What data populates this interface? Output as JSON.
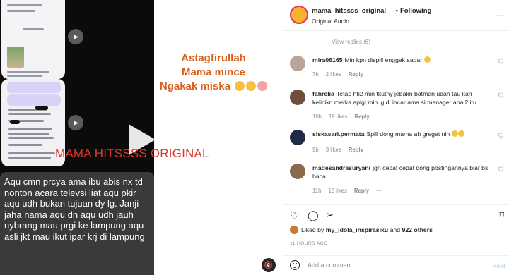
{
  "media": {
    "watermark": "MAMA HITSSSS ORIGINAL",
    "caption_lines": [
      "Astagfirullah",
      "Mama mince",
      "Ngakak miska"
    ],
    "chat_text": "Aqu cmn prcya ama ibu abis nx td nonton acara televsi liat aqu pkir aqu udh bukan tujuan dy lg. Janji jaha nama aqu dn aqu udh jauh nybrang mau prgi ke lampung aqu asli jkt mau ikut ipar krj di lampung",
    "icons": [
      "play-icon",
      "send-icon",
      "mute-icon"
    ]
  },
  "header": {
    "username": "mama_hitssss_original__",
    "separator": "•",
    "follow_status": "Following",
    "audio": "Original Audio",
    "more": "..."
  },
  "view_replies": "View replies (6)",
  "comments": [
    {
      "user": "mira06165",
      "text": "Min kpn dispill enggak sabar",
      "time": "7h",
      "likes": "2 likes",
      "reply": "Reply"
    },
    {
      "user": "fahrelia",
      "text": "Tetap hti2 min tkutny jebakn batman udah tau kan kelicikn merka aplgi min lg di incar ama si manager abal2 itu",
      "time": "10h",
      "likes": "19 likes",
      "reply": "Reply"
    },
    {
      "user": "siskasari.permata",
      "text": "Spill dong mama ah greget nih",
      "time": "9h",
      "likes": "3 likes",
      "reply": "Reply"
    },
    {
      "user": "madesandrasuryani",
      "text": "jgn cepat cepat dong postingannya biar bs baca",
      "time": "11h",
      "likes": "13 likes",
      "reply": "Reply",
      "more": "···"
    }
  ],
  "likes": {
    "prefix": "Liked by",
    "user": "my_idola_inspirasiku",
    "middle": "and",
    "count": "922 others"
  },
  "timestamp": "11 HOURS AGO",
  "add_comment": {
    "placeholder": "Add a comment...",
    "post": "Post"
  },
  "colors": {
    "accent_ring": "#e1306c",
    "caption": "#d95f1c",
    "watermark": "#d93a2b",
    "post_disabled": "#b2dffc"
  }
}
